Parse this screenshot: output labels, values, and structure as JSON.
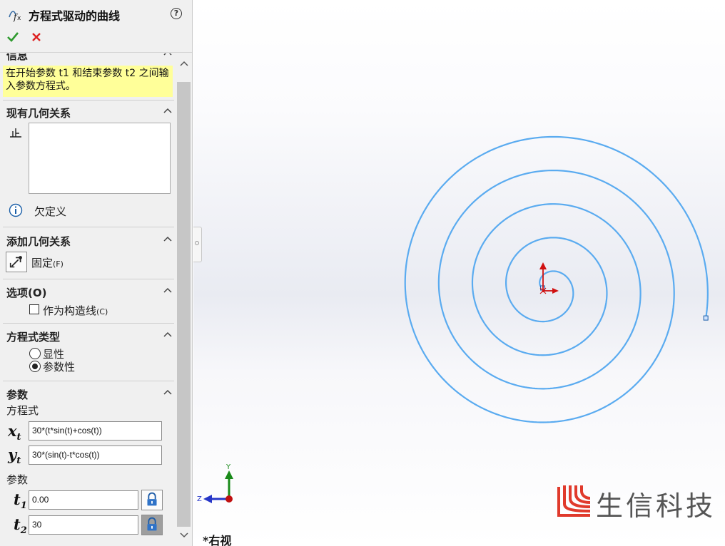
{
  "panel": {
    "title": "方程式驱动的曲线",
    "help_icon_text": "?",
    "ok_icon": "checkmark-icon",
    "cancel_icon": "x-icon"
  },
  "sections": {
    "info": {
      "title": "信息",
      "message": "在开始参数 t1 和结束参数 t2 之间输入参数方程式。"
    },
    "existing_relations": {
      "title": "现有几何关系",
      "status": "欠定义"
    },
    "add_relations": {
      "title": "添加几何关系",
      "fix_label": "固定",
      "fix_shortcut": "(F)"
    },
    "options": {
      "title": "选项(O)",
      "construction_label": "作为构造线",
      "construction_shortcut": "(C)",
      "construction_checked": false
    },
    "equation_type": {
      "title": "方程式类型",
      "options": [
        "显性",
        "参数性"
      ],
      "selected": "参数性"
    },
    "parameters": {
      "title": "参数",
      "equation_label": "方程式",
      "xt_symbol": "x",
      "xt_sub": "t",
      "xt_value": "30*(t*sin(t)+cos(t))",
      "yt_symbol": "y",
      "yt_sub": "t",
      "yt_value": "30*(sin(t)-t*cos(t))",
      "param_label": "参数",
      "t1_symbol": "t",
      "t1_sub": "1",
      "t1_value": "0.00",
      "t2_symbol": "t",
      "t2_sub": "2",
      "t2_value": "30"
    }
  },
  "viewport": {
    "view_name": "*右视",
    "triad_y_label": "Y",
    "triad_z_label": "Z",
    "curve_color": "#5aabf0",
    "watermark_text": "生信科技"
  }
}
